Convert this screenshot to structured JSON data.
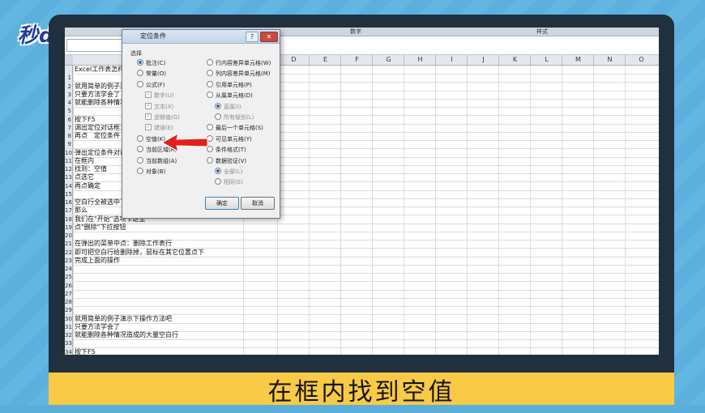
{
  "brand": {
    "logo_text": "秒dong视频"
  },
  "caption": {
    "text": "在框内找到空值"
  },
  "ribbon": {
    "labels": [
      "数字",
      "样式"
    ]
  },
  "sheet": {
    "columns": [
      "D",
      "E",
      "F",
      "G",
      "H",
      "I",
      "J",
      "K",
      "L",
      "M",
      "N",
      "O"
    ],
    "rows": [
      {
        "num": "",
        "text": "Excel工作表怎样快"
      },
      {
        "num": "1",
        "text": ""
      },
      {
        "num": "2",
        "text": "就用简单的例子演"
      },
      {
        "num": "3",
        "text": "只要方法学会了"
      },
      {
        "num": "4",
        "text": "就能删除各种情况"
      },
      {
        "num": "5",
        "text": ""
      },
      {
        "num": "6",
        "text": "按下F5"
      },
      {
        "num": "7",
        "text": "调出定位对话框："
      },
      {
        "num": "8",
        "text": "再点　定位条件"
      },
      {
        "num": "9",
        "text": ""
      },
      {
        "num": "10",
        "text": "弹出定位条件对话"
      },
      {
        "num": "11",
        "text": "在框内"
      },
      {
        "num": "12",
        "text": "找到：空值"
      },
      {
        "num": "13",
        "text": "点选它"
      },
      {
        "num": "14",
        "text": "再点确定"
      },
      {
        "num": "15",
        "text": ""
      },
      {
        "num": "16",
        "text": "空白行全被选中了"
      },
      {
        "num": "17",
        "text": "那么"
      },
      {
        "num": "18",
        "text": "我们在\"开始\"选项卡这里"
      },
      {
        "num": "19",
        "text": "点\"删除\"下拉按钮"
      },
      {
        "num": "20",
        "text": ""
      },
      {
        "num": "21",
        "text": "在弹出的菜单中点：删除工作表行"
      },
      {
        "num": "22",
        "text": "即可把空白行给删除掉，鼠标在其它位置点下"
      },
      {
        "num": "23",
        "text": "完成上面的操作"
      },
      {
        "num": "24",
        "text": ""
      },
      {
        "num": "25",
        "text": ""
      },
      {
        "num": "26",
        "text": ""
      },
      {
        "num": "27",
        "text": ""
      },
      {
        "num": "28",
        "text": ""
      },
      {
        "num": "29",
        "text": ""
      },
      {
        "num": "30",
        "text": "就用简单的例子演示下操作方法吧"
      },
      {
        "num": "31",
        "text": "只要方法学会了"
      },
      {
        "num": "32",
        "text": "就能删除各种情况造成的大量空白行"
      },
      {
        "num": "33",
        "text": ""
      },
      {
        "num": "34",
        "text": "按下F5"
      }
    ]
  },
  "dialog": {
    "title": "定位条件",
    "help": "?",
    "close": "✕",
    "group_label": "选择",
    "left_options": [
      {
        "label": "批注(C)",
        "kind": "radio",
        "checked": true,
        "disabled": false
      },
      {
        "label": "常量(O)",
        "kind": "radio",
        "checked": false,
        "disabled": false
      },
      {
        "label": "公式(F)",
        "kind": "radio",
        "checked": false,
        "disabled": false
      },
      {
        "label": "数字(U)",
        "kind": "check",
        "checked": true,
        "disabled": true
      },
      {
        "label": "文本(X)",
        "kind": "check",
        "checked": true,
        "disabled": true
      },
      {
        "label": "逻辑值(G)",
        "kind": "check",
        "checked": true,
        "disabled": true
      },
      {
        "label": "错误(E)",
        "kind": "check",
        "checked": true,
        "disabled": true
      },
      {
        "label": "空值(K)",
        "kind": "radio",
        "checked": false,
        "disabled": false
      },
      {
        "label": "当前区域(R)",
        "kind": "radio",
        "checked": false,
        "disabled": false
      },
      {
        "label": "当前数组(A)",
        "kind": "radio",
        "checked": false,
        "disabled": false
      },
      {
        "label": "对象(B)",
        "kind": "radio",
        "checked": false,
        "disabled": false
      }
    ],
    "right_options": [
      {
        "label": "行内容差异单元格(W)",
        "kind": "radio",
        "checked": false,
        "disabled": false
      },
      {
        "label": "列内容差异单元格(M)",
        "kind": "radio",
        "checked": false,
        "disabled": false
      },
      {
        "label": "引用单元格(P)",
        "kind": "radio",
        "checked": false,
        "disabled": false
      },
      {
        "label": "从属单元格(D)",
        "kind": "radio",
        "checked": false,
        "disabled": false
      },
      {
        "label": "直属(I)",
        "kind": "radio",
        "checked": true,
        "disabled": true
      },
      {
        "label": "所有级别(L)",
        "kind": "radio",
        "checked": false,
        "disabled": true
      },
      {
        "label": "最后一个单元格(S)",
        "kind": "radio",
        "checked": false,
        "disabled": false
      },
      {
        "label": "可见单元格(Y)",
        "kind": "radio",
        "checked": false,
        "disabled": false
      },
      {
        "label": "条件格式(T)",
        "kind": "radio",
        "checked": false,
        "disabled": false
      },
      {
        "label": "数据验证(V)",
        "kind": "radio",
        "checked": false,
        "disabled": false
      },
      {
        "label": "全部(L)",
        "kind": "radio",
        "checked": true,
        "disabled": true
      },
      {
        "label": "相同(E)",
        "kind": "radio",
        "checked": false,
        "disabled": true
      }
    ],
    "ok_label": "确定",
    "cancel_label": "取消"
  },
  "colors": {
    "arrow": "#e3201b",
    "caption_bar": "#f9ca45",
    "monitor": "#20303e"
  }
}
